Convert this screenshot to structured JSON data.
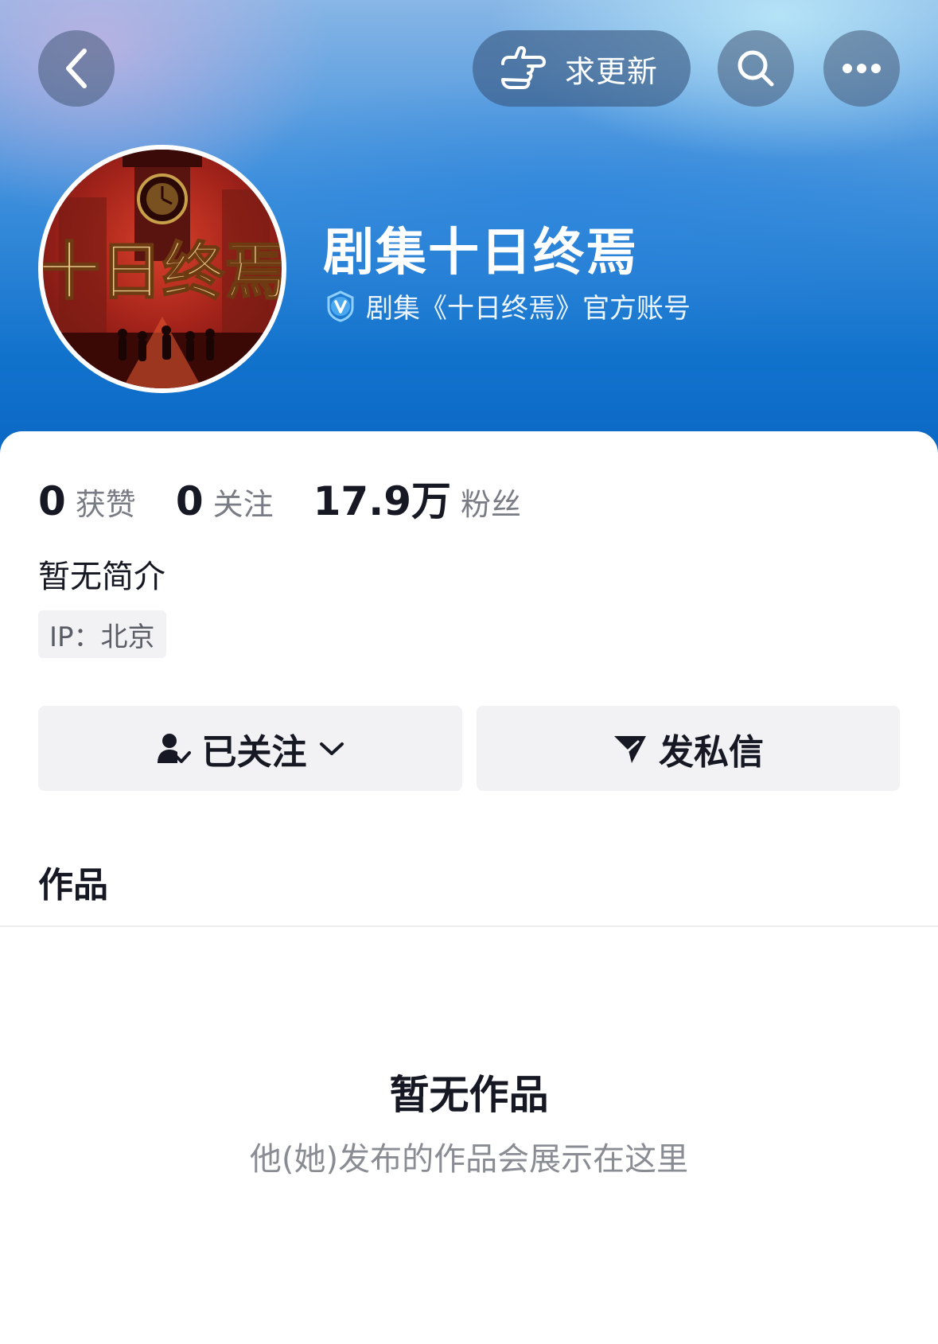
{
  "header": {
    "request_update_label": "求更新"
  },
  "profile": {
    "name": "剧集十日终焉",
    "verify_text": "剧集《十日终焉》官方账号",
    "avatar_text": "十日终焉"
  },
  "stats": [
    {
      "value": "0",
      "label": "获赞"
    },
    {
      "value": "0",
      "label": "关注"
    },
    {
      "value": "17.9万",
      "label": "粉丝"
    }
  ],
  "bio": "暂无简介",
  "ip_tag": "IP：北京",
  "actions": {
    "followed_label": "已关注",
    "message_label": "发私信"
  },
  "works": {
    "section_title": "作品",
    "empty_title": "暂无作品",
    "empty_subtitle": "他(她)发布的作品会展示在这里"
  },
  "colors": {
    "header_blue": "#1172cc",
    "text_primary": "#161823",
    "text_secondary": "#7a7c85",
    "button_bg": "#f2f2f4"
  }
}
